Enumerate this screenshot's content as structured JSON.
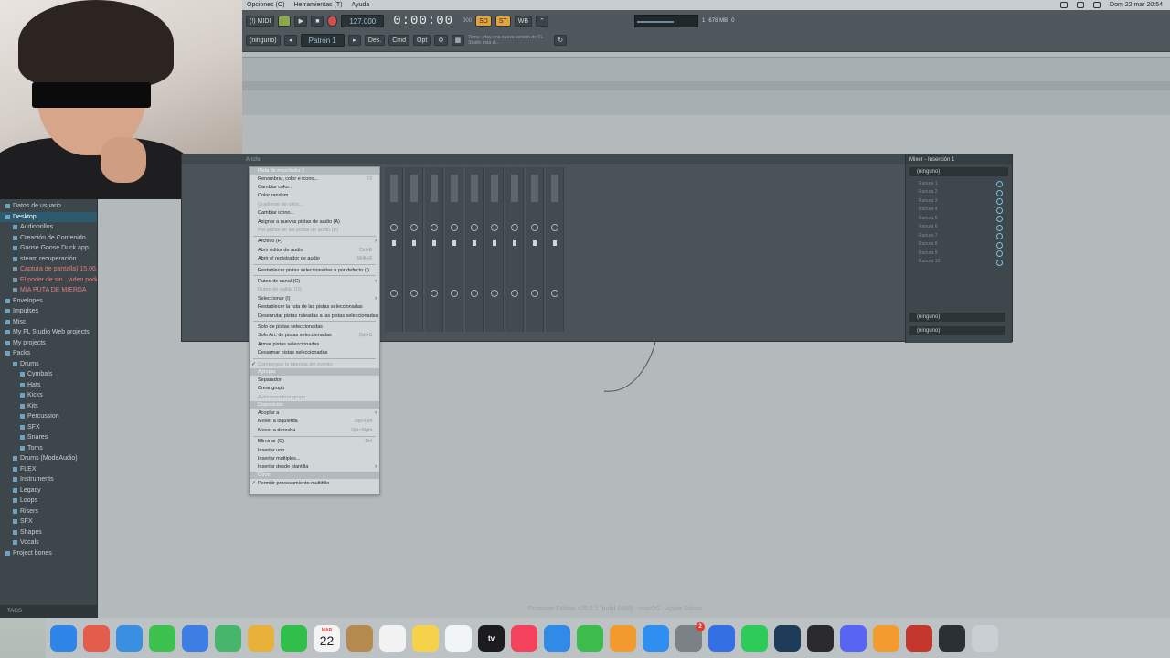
{
  "menubar": {
    "menus": [
      "Opciones (O)",
      "Herramientas (T)",
      "Ayuda"
    ],
    "datetime": "Dom 22 mar 20:54"
  },
  "toolbar": {
    "midi_label": "(!) MIDI",
    "tempo": "127.000",
    "time": "0:00:00",
    "time_suffix": "000",
    "pattern": "Patrón 1",
    "mode": "(ninguno)",
    "btn_des": "Des.",
    "btn_cmd": "Cmd",
    "btn_opt": "Opt",
    "hint": "Tema: ¡Hay una nueva versión de FL Studio esta di...",
    "cpu": "1",
    "mem": "678 MB",
    "poly": "0",
    "mode_labels": [
      "SD",
      "ST",
      "WB"
    ]
  },
  "webcam": {
    "label": "webcam-feed"
  },
  "browser": {
    "items": [
      {
        "label": "Datos de usuario",
        "type": "folder",
        "level": 0
      },
      {
        "label": "Desktop",
        "type": "folder",
        "level": 0,
        "selected": true
      },
      {
        "label": "Audiobrillos",
        "type": "folder",
        "level": 1
      },
      {
        "label": "Creación de Contenido",
        "type": "folder",
        "level": 1
      },
      {
        "label": "Goose Goose Duck.app",
        "type": "folder",
        "level": 1
      },
      {
        "label": "steam recuperación",
        "type": "folder",
        "level": 1
      },
      {
        "label": "Captura de pantalla) 15.06.21",
        "type": "file",
        "level": 1,
        "highlight": true
      },
      {
        "label": "El poder de sin...video podcast",
        "type": "file",
        "level": 1,
        "highlight": true
      },
      {
        "label": "MIA PUTA DE MIERDA",
        "type": "file",
        "level": 1,
        "highlight": true
      },
      {
        "label": "Envelopes",
        "type": "folder",
        "level": 0
      },
      {
        "label": "Impulses",
        "type": "folder",
        "level": 0
      },
      {
        "label": "Misc",
        "type": "folder",
        "level": 0
      },
      {
        "label": "My FL Studio Web projects",
        "type": "folder",
        "level": 0
      },
      {
        "label": "My projects",
        "type": "folder",
        "level": 0
      },
      {
        "label": "Packs",
        "type": "folder",
        "level": 0
      },
      {
        "label": "Drums",
        "type": "folder",
        "level": 1
      },
      {
        "label": "Cymbals",
        "type": "folder",
        "level": 2
      },
      {
        "label": "Hats",
        "type": "folder",
        "level": 2
      },
      {
        "label": "Kicks",
        "type": "folder",
        "level": 2
      },
      {
        "label": "Kits",
        "type": "folder",
        "level": 2
      },
      {
        "label": "Percussion",
        "type": "folder",
        "level": 2
      },
      {
        "label": "SFX",
        "type": "folder",
        "level": 2
      },
      {
        "label": "Snares",
        "type": "folder",
        "level": 2
      },
      {
        "label": "Toms",
        "type": "folder",
        "level": 2
      },
      {
        "label": "Drums (ModeAudio)",
        "type": "folder",
        "level": 1
      },
      {
        "label": "FLEX",
        "type": "folder",
        "level": 1
      },
      {
        "label": "Instruments",
        "type": "folder",
        "level": 1
      },
      {
        "label": "Legacy",
        "type": "folder",
        "level": 1
      },
      {
        "label": "Loops",
        "type": "folder",
        "level": 1
      },
      {
        "label": "Risers",
        "type": "folder",
        "level": 1
      },
      {
        "label": "SFX",
        "type": "folder",
        "level": 1
      },
      {
        "label": "Shapes",
        "type": "folder",
        "level": 1
      },
      {
        "label": "Vocals",
        "type": "folder",
        "level": 1
      },
      {
        "label": "Project bones",
        "type": "folder",
        "level": 0
      }
    ],
    "footer": "TAGS"
  },
  "mixer": {
    "title": "Ancho",
    "strip_count": 9,
    "insert_panel": {
      "title": "Mixer - Inserción 1",
      "selector": "(ninguno)",
      "slots": [
        "Ranura 1",
        "Ranura 2",
        "Ranura 3",
        "Ranura 4",
        "Ranura 5",
        "Ranura 6",
        "Ranura 7",
        "Ranura 8",
        "Ranura 9",
        "Ranura 10"
      ],
      "bottom_1": "(ninguno)",
      "bottom_2": "(ninguno)"
    }
  },
  "context_menu": {
    "items": [
      {
        "label": "Pista de mezclador 1",
        "kind": "head"
      },
      {
        "label": "Renombrar, color e icono...",
        "shortcut": "F2"
      },
      {
        "label": "Cambiar color..."
      },
      {
        "label": "Color random"
      },
      {
        "label": "Gradiente de color...",
        "disabled": true
      },
      {
        "label": "Cambiar icono..."
      },
      {
        "label": "Asignar a nuevas pistas de audio (A)"
      },
      {
        "label": "Por pistas de las pistas de audio (P)",
        "disabled": true
      },
      {
        "kind": "sep"
      },
      {
        "label": "Archivo (F)",
        "submenu": true
      },
      {
        "label": "Abrir editor de audio",
        "shortcut": "Ctrl+E"
      },
      {
        "label": "Abrir el registrador de audio",
        "shortcut": "Shift+R"
      },
      {
        "kind": "sep"
      },
      {
        "label": "Restablecer pistas seleccionadas a por defecto (I)"
      },
      {
        "kind": "sep"
      },
      {
        "label": "Ruteo de canal (C)",
        "submenu": true
      },
      {
        "label": "Ruteo de salida (O)",
        "disabled": true
      },
      {
        "label": "Seleccionar (I)",
        "submenu": true
      },
      {
        "label": "Restablecer la ruta de las pistas seleccionadas"
      },
      {
        "label": "Desenrutar pistas ruteadas a las pistas seleccionadas"
      },
      {
        "kind": "sep"
      },
      {
        "label": "Solo de pistas seleccionadas"
      },
      {
        "label": "Solo Art. de pistas seleccionadas",
        "shortcut": "Opt+S"
      },
      {
        "label": "Armar pistas seleccionadas"
      },
      {
        "label": "Desarmar pistas seleccionadas"
      },
      {
        "kind": "sep"
      },
      {
        "label": "Compensar la latencia del evento",
        "disabled": true,
        "checked": true
      },
      {
        "label": "Agrupar",
        "kind": "head"
      },
      {
        "label": "Separador"
      },
      {
        "label": "Crear grupo"
      },
      {
        "label": "Autorenombrar grupo",
        "disabled": true
      },
      {
        "label": "Disposición",
        "kind": "head"
      },
      {
        "label": "Acoplar a",
        "submenu": true
      },
      {
        "label": "Mover a izquierda",
        "shortcut": "Opt+Left"
      },
      {
        "label": "Mover a derecha",
        "shortcut": "Opt+Right"
      },
      {
        "kind": "sep"
      },
      {
        "label": "Eliminar (D)",
        "shortcut": "Del"
      },
      {
        "label": "Insertar uno"
      },
      {
        "label": "Insertar múltiples..."
      },
      {
        "label": "Insertar desde plantilla",
        "submenu": true
      },
      {
        "label": "Otros",
        "kind": "head"
      },
      {
        "label": "Permitir procesamiento multihilo",
        "checked": true
      }
    ]
  },
  "status_text": "Producer Edition v25.2.1 [build 4889] - macOS - Apple Silicon",
  "dock": {
    "apps": [
      {
        "name": "finder",
        "label": "",
        "color": "#2f86e8"
      },
      {
        "name": "launchpad",
        "label": "",
        "color": "#e45c4c"
      },
      {
        "name": "safari",
        "label": "",
        "color": "#3a8fe0"
      },
      {
        "name": "messages",
        "label": "",
        "color": "#3ec24f"
      },
      {
        "name": "mail",
        "label": "",
        "color": "#3d7ee5"
      },
      {
        "name": "maps",
        "label": "",
        "color": "#47b56b"
      },
      {
        "name": "photos",
        "label": "",
        "color": "#e8b23a"
      },
      {
        "name": "facetime",
        "label": "",
        "color": "#2fbf4a"
      },
      {
        "name": "calendar",
        "label": "22",
        "month": "MAR",
        "color": "#f4f4f4"
      },
      {
        "name": "contacts",
        "label": "",
        "color": "#b58a4f"
      },
      {
        "name": "reminders",
        "label": "",
        "color": "#f2f2f2"
      },
      {
        "name": "notes",
        "label": "",
        "color": "#f6d24a"
      },
      {
        "name": "freeform",
        "label": "",
        "color": "#f1f5f8"
      },
      {
        "name": "tv",
        "label": "tv",
        "color": "#1c1c1e"
      },
      {
        "name": "music",
        "label": "",
        "color": "#f5425c"
      },
      {
        "name": "keynote",
        "label": "",
        "color": "#2f8be6"
      },
      {
        "name": "numbers",
        "label": "",
        "color": "#3dbb4d"
      },
      {
        "name": "pages",
        "label": "",
        "color": "#f39a2e"
      },
      {
        "name": "app-store",
        "label": "",
        "color": "#2e8ff0"
      },
      {
        "name": "system-settings",
        "label": "",
        "color": "#7b8185",
        "badge": "2"
      },
      {
        "name": "roblox",
        "label": "",
        "color": "#3470e3"
      },
      {
        "name": "whatsapp",
        "label": "",
        "color": "#2ecb5a"
      },
      {
        "name": "steam",
        "label": "",
        "color": "#1e3b5a"
      },
      {
        "name": "obs",
        "label": "",
        "color": "#2a2a2e"
      },
      {
        "name": "discord",
        "label": "",
        "color": "#5865f2"
      },
      {
        "name": "fl-studio",
        "label": "",
        "color": "#f29b2e"
      },
      {
        "name": "photo-booth",
        "label": "",
        "color": "#c4372c"
      },
      {
        "name": "screenshot",
        "label": "",
        "color": "#2b3035"
      },
      {
        "name": "trash",
        "label": "",
        "color": "#c9cfd2"
      }
    ]
  }
}
